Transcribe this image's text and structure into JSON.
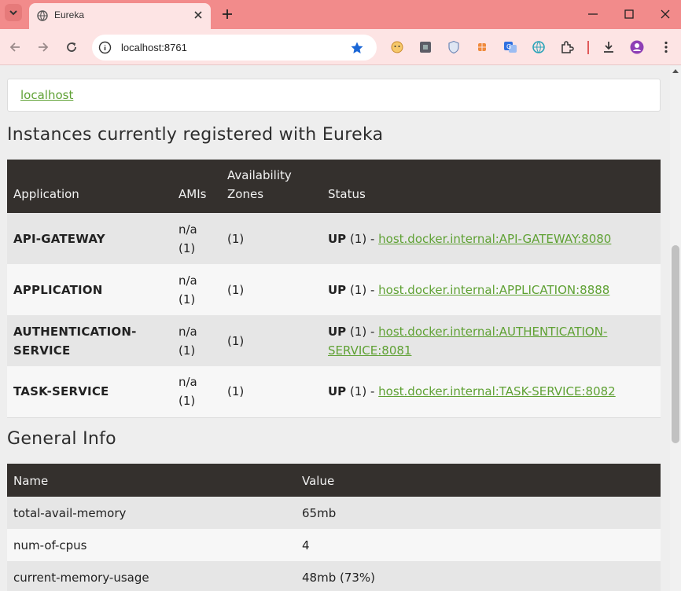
{
  "browser": {
    "tab_title": "Eureka",
    "url": "localhost:8761"
  },
  "page": {
    "host_link": "localhost",
    "instances_heading": "Instances currently registered with Eureka",
    "instances_table": {
      "headers": [
        "Application",
        "AMIs",
        "Availability Zones",
        "Status"
      ],
      "rows": [
        {
          "application": "API-GATEWAY",
          "amis": "n/a (1)",
          "zones": "(1)",
          "status_up": "UP",
          "status_count": " (1) - ",
          "link": "host.docker.internal:API-GATEWAY:8080"
        },
        {
          "application": "APPLICATION",
          "amis": "n/a (1)",
          "zones": "(1)",
          "status_up": "UP",
          "status_count": " (1) - ",
          "link": "host.docker.internal:APPLICATION:8888"
        },
        {
          "application": "AUTHENTICATION-SERVICE",
          "amis": "n/a (1)",
          "zones": "(1)",
          "status_up": "UP",
          "status_count": " (1) - ",
          "link": "host.docker.internal:AUTHENTICATION-SERVICE:8081"
        },
        {
          "application": "TASK-SERVICE",
          "amis": "n/a (1)",
          "zones": "(1)",
          "status_up": "UP",
          "status_count": " (1) - ",
          "link": "host.docker.internal:TASK-SERVICE:8082"
        }
      ]
    },
    "general_heading": "General Info",
    "general_table": {
      "headers": [
        "Name",
        "Value"
      ],
      "rows": [
        {
          "name": "total-avail-memory",
          "value": "65mb"
        },
        {
          "name": "num-of-cpus",
          "value": "4"
        },
        {
          "name": "current-memory-usage",
          "value": "48mb (73%)"
        }
      ]
    }
  },
  "colors": {
    "tabbar": "#f28b8b",
    "toolbar": "#fde4e4",
    "table_header": "#34302d",
    "link": "#5fa134"
  }
}
